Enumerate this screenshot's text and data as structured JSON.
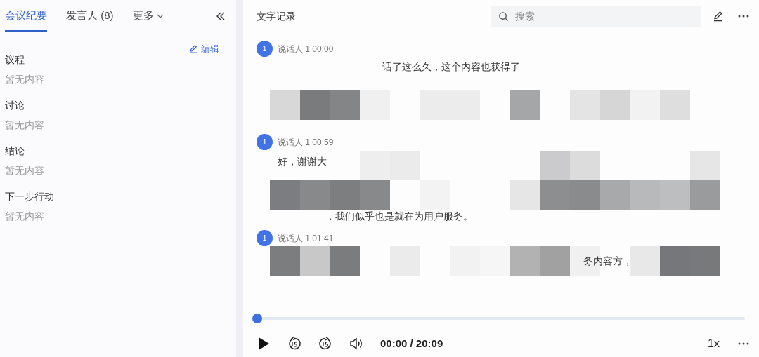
{
  "tabs": [
    {
      "label": "会议纪要",
      "selected": true,
      "kind": "tab"
    },
    {
      "label": "发言人 (8)",
      "selected": false,
      "kind": "tab"
    },
    {
      "label": "更多",
      "selected": false,
      "kind": "dropdown"
    }
  ],
  "edit_link": "编辑",
  "sections": [
    {
      "title": "议程",
      "content": "暂无内容"
    },
    {
      "title": "讨论",
      "content": "暂无内容"
    },
    {
      "title": "结论",
      "content": "暂无内容"
    },
    {
      "title": "下一步行动",
      "content": "暂无内容"
    }
  ],
  "transcript": {
    "title": "文字记录",
    "search": {
      "placeholder": "搜索"
    },
    "entries": [
      {
        "avatar": "1",
        "speaker": "说话人 1",
        "time": "00:00",
        "lines": [
          "话了这么久，这个内容也获得了"
        ]
      },
      {
        "avatar": "1",
        "speaker": "说话人 1",
        "time": "00:59",
        "lines": [
          "好，谢谢大",
          "，我们似乎也是就在为用户服务。"
        ]
      },
      {
        "avatar": "1",
        "speaker": "说话人 1",
        "time": "01:41",
        "lines": [
          "务内容方，"
        ]
      }
    ]
  },
  "player": {
    "progress": {
      "level": 0
    },
    "time": "00:00 / 20:09",
    "speed": "1x"
  }
}
